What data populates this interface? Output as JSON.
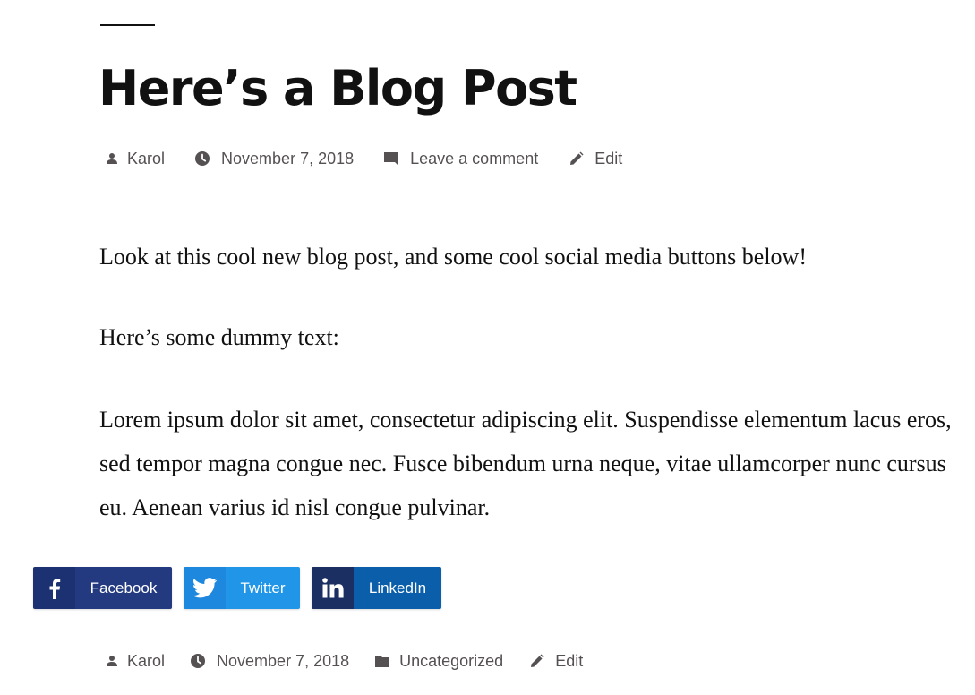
{
  "post": {
    "title": "Here’s a Blog Post",
    "meta_top": {
      "author": "Karol",
      "date": "November 7, 2018",
      "comments": "Leave a comment",
      "edit": "Edit"
    },
    "paragraphs": [
      "Look at this cool new blog post, and some cool social media buttons below!",
      "Here’s some dummy text:",
      "Lorem ipsum dolor sit amet, consectetur adipiscing elit. Suspendisse elementum lacus eros, sed tempor magna congue nec. Fusce bibendum urna neque, vitae ullamcorper nunc cursus eu. Aenean varius id nisl congue pulvinar."
    ],
    "meta_bottom": {
      "author": "Karol",
      "date": "November 7, 2018",
      "category": "Uncategorized",
      "edit": "Edit"
    }
  },
  "share_buttons": [
    {
      "label": "Facebook",
      "icon": "facebook-icon",
      "color": "#233a80"
    },
    {
      "label": "Twitter",
      "icon": "twitter-icon",
      "color": "#2196e8"
    },
    {
      "label": "LinkedIn",
      "icon": "linkedin-icon",
      "color": "#0b5faa"
    }
  ],
  "colors": {
    "text": "#111111",
    "meta_text": "#555152"
  }
}
